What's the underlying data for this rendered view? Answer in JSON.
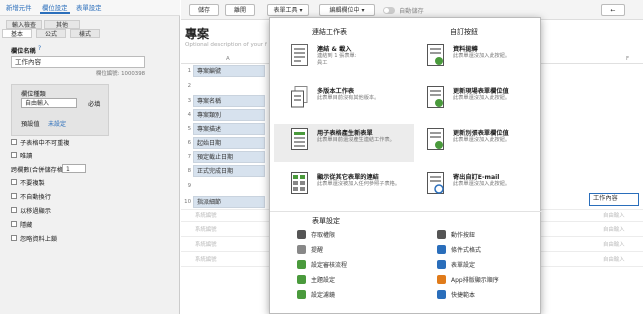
{
  "top_tabs": [
    "新增元件",
    "欄位設定",
    "表單設定"
  ],
  "left_panel": {
    "subtabs_top": [
      "輸入檢查",
      "其他"
    ],
    "subtabs_bottom": [
      "基本",
      "公式",
      "樣式"
    ],
    "field_name_label": "欄位名稱",
    "field_name_value": "工作內容",
    "field_code": "欄位編號: 1000398",
    "field_type_label": "欄位種類",
    "field_type_value": "自由輸入",
    "required_label": "必填",
    "default_label": "預設值",
    "default_value": "未設定",
    "checks": [
      "子表格中不可重複",
      "唯讀",
      "跨欄數(合併儲存格)",
      "不要複製",
      "不自動換行",
      "以移過顯示",
      "隱藏",
      "忽略資料上鎖"
    ],
    "colspan_value": "1"
  },
  "toolbar": {
    "save": "儲存",
    "close": "離開",
    "form_tools": "表單工具",
    "edit_fields": "編輯欄位中",
    "autosave": "自動儲存",
    "back_arrow": "←"
  },
  "form": {
    "title": "專案",
    "subtitle": "Optional description of your f",
    "col_a": "A",
    "col_f": "F",
    "rows": [
      {
        "num": "1",
        "label": "專案編號"
      },
      {
        "num": "2",
        "label": ""
      },
      {
        "num": "3",
        "label": "專案名稱"
      },
      {
        "num": "4",
        "label": "專案類別"
      },
      {
        "num": "5",
        "label": "專案描述"
      },
      {
        "num": "6",
        "label": "起始日期"
      },
      {
        "num": "7",
        "label": "預定截止日期"
      },
      {
        "num": "8",
        "label": "正式完成日期"
      },
      {
        "num": "9",
        "label": ""
      },
      {
        "num": "10",
        "label": "指派細節"
      }
    ],
    "sub_rows": [
      "系統編號",
      "系統編號",
      "系統編號",
      "系統編號"
    ],
    "input_placeholder": "自由輸入",
    "selected_cell": "工作內容"
  },
  "menu": {
    "left_header": "連結工作表",
    "right_header": "自訂按鈕",
    "left_items": [
      {
        "title": "連結 & 載入",
        "desc1": "連結到 1 張表單:",
        "desc2": "員工"
      },
      {
        "title": "多版本工作表",
        "desc1": "此表單目前沒有其他版本。",
        "desc2": ""
      },
      {
        "title": "用子表格產生新表單",
        "desc1": "此表單目前還沒產生連結工作表。",
        "desc2": ""
      },
      {
        "title": "顯示從其它表單的連結",
        "desc1": "此表單還沒被加入任何參照子表格。",
        "desc2": ""
      }
    ],
    "right_items": [
      {
        "title": "資料拋轉",
        "desc1": "此表單還沒加入此按鈕。"
      },
      {
        "title": "更新現場表單欄位值",
        "desc1": "此表單還沒加入此按鈕。"
      },
      {
        "title": "更新別張表單欄位值",
        "desc1": "此表單還沒加入此按鈕。"
      },
      {
        "title": "寄出自訂E-mail",
        "desc1": "此表單還沒加入此按鈕。"
      }
    ],
    "settings_header": "表單設定",
    "settings_left": [
      "存取權限",
      "提醒",
      "設定審核流程",
      "主題設定",
      "設定濾鏡"
    ],
    "settings_right": [
      "動作按鈕",
      "條件式格式",
      "表單設定",
      "App排版顯示順序",
      "快捷範本"
    ],
    "colors": {
      "accent": "#2a6ebb",
      "green": "#4a9a3c",
      "highlight": "#ececec"
    }
  }
}
